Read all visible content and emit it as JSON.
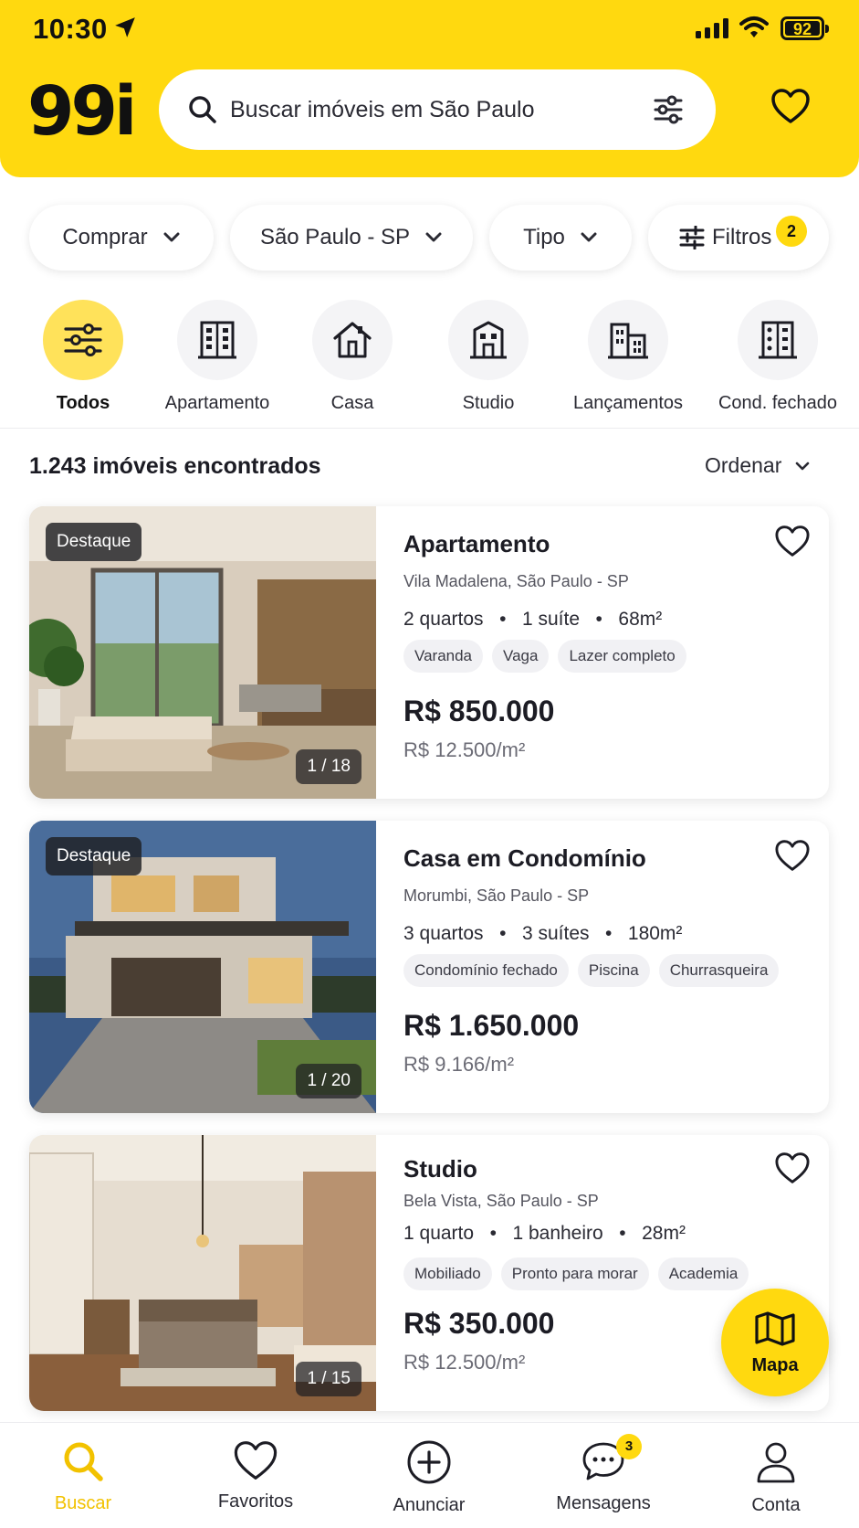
{
  "status_bar": {
    "time": "10:30",
    "battery": "92"
  },
  "header": {
    "logo": "99i",
    "search_placeholder": "Buscar imóveis em São Paulo"
  },
  "filters": [
    {
      "label": "Comprar"
    },
    {
      "label": "São Paulo - SP"
    },
    {
      "label": "Tipo"
    },
    {
      "label": "Filtros",
      "badge": "2"
    }
  ],
  "categories": [
    {
      "label": "Todos",
      "icon": "sliders-icon",
      "active": true
    },
    {
      "label": "Apartamento",
      "icon": "apartment-building-icon"
    },
    {
      "label": "Casa",
      "icon": "house-icon"
    },
    {
      "label": "Studio",
      "icon": "studio-building-icon"
    },
    {
      "label": "Lançamentos",
      "icon": "new-buildings-icon"
    },
    {
      "label": "Cond. fechado",
      "icon": "gated-condo-icon"
    }
  ],
  "results": {
    "count_text": "1.243 imóveis encontrados",
    "sort_label": "Ordenar"
  },
  "listings": [
    {
      "badge": "Destaque",
      "photo_counter": "1 / 18",
      "title": "Apartamento",
      "address": "Vila Madalena, São Paulo - SP",
      "specs": [
        "2 quartos",
        "1 suíte",
        "68m²"
      ],
      "tags": [
        "Varanda",
        "Vaga",
        "Lazer completo"
      ],
      "price": "R$ 850.000",
      "price_per_m2": "R$ 12.500/m²"
    },
    {
      "badge": "Destaque",
      "photo_counter": "1 / 20",
      "title": "Casa em Condomínio",
      "address": "Morumbi, São Paulo - SP",
      "specs": [
        "3 quartos",
        "3 suítes",
        "180m²"
      ],
      "tags": [
        "Condomínio fechado",
        "Piscina",
        "Churrasqueira"
      ],
      "price": "R$ 1.650.000",
      "price_per_m2": "R$ 9.166/m²"
    },
    {
      "photo_counter": "1 / 15",
      "title": "Studio",
      "address": "Bela Vista, São Paulo - SP",
      "specs": [
        "1 quarto",
        "1 banheiro",
        "28m²"
      ],
      "tags": [
        "Mobiliado",
        "Pronto para morar",
        "Academia"
      ],
      "price": "R$ 350.000",
      "price_per_m2": "R$ 12.500/m²"
    }
  ],
  "map_button": {
    "label": "Mapa"
  },
  "bottom_nav": [
    {
      "label": "Buscar",
      "icon": "search-icon",
      "active": true
    },
    {
      "label": "Favoritos",
      "icon": "heart-icon"
    },
    {
      "label": "Anunciar",
      "icon": "plus-circle-icon"
    },
    {
      "label": "Mensagens",
      "icon": "chat-icon",
      "badge": "3"
    },
    {
      "label": "Conta",
      "icon": "user-icon"
    }
  ],
  "colors": {
    "brand_yellow": "#ffd90f",
    "text_dark": "#1c1c24",
    "muted": "#6b6b75"
  }
}
